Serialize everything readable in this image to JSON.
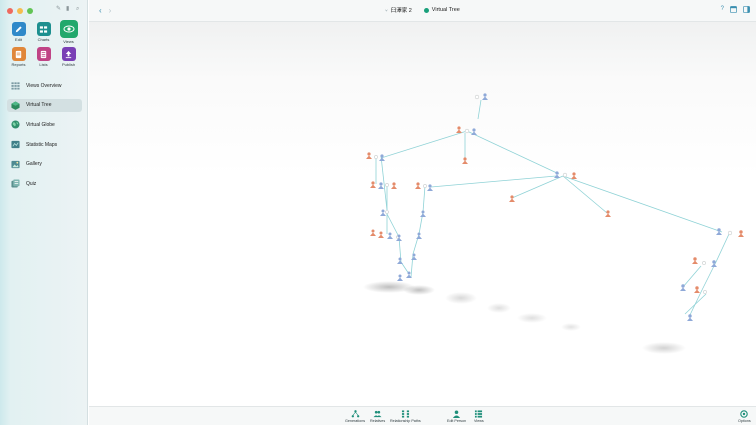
{
  "window": {
    "traffic_lights": [
      "#ee6a5f",
      "#f5bd4f",
      "#61c454"
    ]
  },
  "sidebar": {
    "modes": [
      {
        "label": "Edit",
        "icon": "edit-icon",
        "color": "#2f89c9"
      },
      {
        "label": "Charts",
        "icon": "charts-icon",
        "color": "#1d8f8f"
      },
      {
        "label": "Views",
        "icon": "eye-icon",
        "color": "#22a86c"
      },
      {
        "label": "Reports",
        "icon": "reports-icon",
        "color": "#e0873a"
      },
      {
        "label": "Lists",
        "icon": "lists-icon",
        "color": "#c04486"
      },
      {
        "label": "Publish",
        "icon": "publish-icon",
        "color": "#7a3fb5"
      }
    ],
    "active_mode": "Views",
    "nav": [
      {
        "label": "Views Overview",
        "icon": "grid-icon"
      },
      {
        "label": "Virtual Tree",
        "icon": "cube-icon"
      },
      {
        "label": "Virtual Globe",
        "icon": "globe-icon"
      },
      {
        "label": "Statistic Maps",
        "icon": "map-icon"
      },
      {
        "label": "Gallery",
        "icon": "gallery-icon"
      },
      {
        "label": "Quiz",
        "icon": "quiz-icon"
      }
    ],
    "active_nav": "Virtual Tree"
  },
  "topbar": {
    "back": "‹",
    "forward": "›",
    "tree_name": "臼澤家 2",
    "view_title": "Virtual Tree",
    "accent": "#3a8fb0"
  },
  "bottombar": {
    "buttons": [
      {
        "label": "Generations",
        "icon": "generations-icon"
      },
      {
        "label": "Relatives",
        "icon": "relatives-icon"
      },
      {
        "label": "Relationship Paths",
        "icon": "relationship-paths-icon"
      },
      {
        "label": "Edit Person",
        "icon": "edit-person-icon"
      },
      {
        "label": "Views",
        "icon": "views-icon"
      },
      {
        "label": "Options",
        "icon": "options-icon"
      }
    ]
  }
}
